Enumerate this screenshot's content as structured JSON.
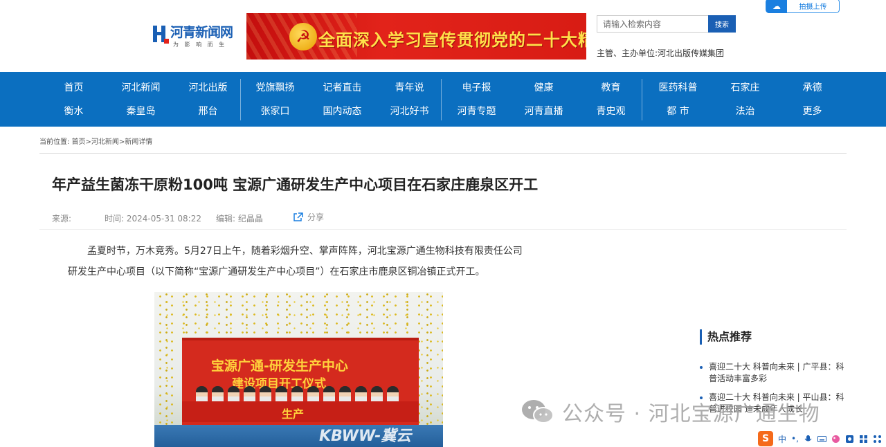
{
  "header": {
    "logo_name": "河青新闻网",
    "logo_slogan": "为 影 响 而 生",
    "banner_text": "全面深入学习宣传贯彻党的二十大精神",
    "search_placeholder": "请输入检索内容",
    "search_button": "搜索",
    "sponsor": "主管、主办单位:河北出版传媒集团",
    "upload_label": "拍摄上传"
  },
  "nav": {
    "row1": [
      "首页",
      "河北新闻",
      "河北出版",
      "党旗飘扬",
      "记者直击",
      "青年说",
      "电子报",
      "健康",
      "教育",
      "医药科普",
      "石家庄",
      "承德"
    ],
    "row2": [
      "衡水",
      "秦皇岛",
      "邢台",
      "张家口",
      "国内动态",
      "河北好书",
      "河青专题",
      "河青直播",
      "青史观",
      "都 市",
      "法治",
      "更多"
    ]
  },
  "breadcrumb": "当前位置: 首页>河北新闻>新闻详情",
  "article": {
    "title": "年产益生菌冻干原粉100吨 宝源广通研发生产中心项目在石家庄鹿泉区开工",
    "source_label": "来源:",
    "time": "时间: 2024-05-31 08:22",
    "editor": "编辑: 纪晶晶",
    "share_label": "分享",
    "para1": "孟夏时节，万木竞秀。5月27日上午，随着彩烟升空、掌声阵阵，河北宝源广通生物科技有限责任公司",
    "para2": "研发生产中心项目（以下简称“宝源广通研发生产中心项目”）在石家庄市鹿泉区铜冶镇正式开工。",
    "photo": {
      "board_line1": "宝源广通-研发生产中心",
      "board_line2": "建设项目开工仪式",
      "stage_text": "生产",
      "watermark": "KBWW-冀云"
    }
  },
  "sidebar": {
    "hot_title": "热点推荐",
    "hot_items": [
      "喜迎二十大 科普向未来 | 广平县：科普活动丰富多彩",
      "喜迎二十大 科普向未来 | 平山县：科普进校园 迪未成年人成长"
    ]
  },
  "overlay": {
    "watermark_text": "公众号 · 河北宝源广通生物"
  },
  "ime": {
    "logo": "S",
    "mode": "中"
  },
  "colors": {
    "nav_blue": "#0b6fc0",
    "brand_blue": "#1a5fb4",
    "banner_red": "#d81c14"
  }
}
